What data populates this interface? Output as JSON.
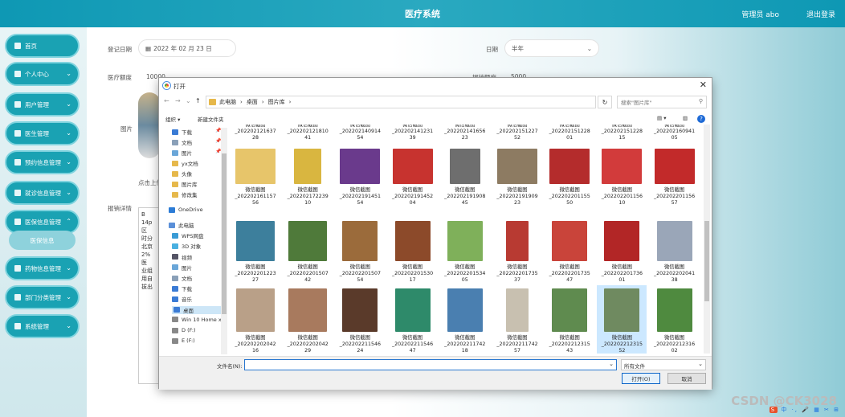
{
  "header": {
    "title": "医疗系统",
    "user": "管理员 abo",
    "logout": "退出登录"
  },
  "sidebar": {
    "items": [
      {
        "label": "首页",
        "arrow": ""
      },
      {
        "label": "个人中心",
        "arrow": "⌄"
      },
      {
        "label": "用户管理",
        "arrow": "⌄"
      },
      {
        "label": "医生管理",
        "arrow": "⌄"
      },
      {
        "label": "预约信息管理",
        "arrow": "⌄"
      },
      {
        "label": "就诊信息管理",
        "arrow": "⌄"
      },
      {
        "label": "医保信息管理",
        "arrow": "⌃"
      },
      {
        "label": "药物信息管理",
        "arrow": "⌄"
      },
      {
        "label": "部门分类管理",
        "arrow": "⌄"
      },
      {
        "label": "系统管理",
        "arrow": "⌄"
      }
    ],
    "sub": "医保信息"
  },
  "form": {
    "date_label": "登记日期",
    "date_value": "2022 年 02 月 23 日",
    "period_label": "日期",
    "period_value": "半年",
    "amount_label": "医疗额度",
    "amount_value": "10000",
    "reimb_label": "报销额度",
    "reimb_value": "5000",
    "image_label": "图片",
    "upload_hint": "点击上传",
    "detail_label": "报销详情",
    "editor_lines": [
      "B",
      "14p",
      "",
      "区",
      "时分",
      "北京",
      "2%",
      "",
      "医",
      "业组",
      "用自",
      "拔出"
    ]
  },
  "dialog": {
    "title": "打开",
    "breadcrumb": [
      "此电脑",
      "›",
      "桌面",
      "›",
      "图片库",
      "›"
    ],
    "search_placeholder": "搜索\"图片库\"",
    "organize": "组织 ▾",
    "new_folder": "新建文件夹",
    "tree": [
      {
        "label": "下载",
        "color": "#3a7bd5",
        "pin": "📌"
      },
      {
        "label": "文档",
        "color": "#8aa0b8",
        "pin": "📌"
      },
      {
        "label": "图片",
        "color": "#6aa6d8",
        "pin": "📌"
      },
      {
        "label": "yx文档",
        "color": "#e6b84b",
        "pin": ""
      },
      {
        "label": "头像",
        "color": "#e6b84b",
        "pin": ""
      },
      {
        "label": "图片库",
        "color": "#e6b84b",
        "pin": ""
      },
      {
        "label": "修改集",
        "color": "#e6b84b",
        "pin": ""
      },
      {
        "label": "OneDrive",
        "color": "#2c7cd6",
        "pin": ""
      },
      {
        "label": "此电脑",
        "color": "#5a8fd8",
        "pin": ""
      },
      {
        "label": "WPS网盘",
        "color": "#3a9bd5",
        "pin": ""
      },
      {
        "label": "3D 对象",
        "color": "#4ab0e0",
        "pin": ""
      },
      {
        "label": "视频",
        "color": "#556",
        "pin": ""
      },
      {
        "label": "图片",
        "color": "#6aa6d8",
        "pin": ""
      },
      {
        "label": "文档",
        "color": "#8aa0b8",
        "pin": ""
      },
      {
        "label": "下载",
        "color": "#3a7bd5",
        "pin": ""
      },
      {
        "label": "音乐",
        "color": "#3a7bd5",
        "pin": ""
      },
      {
        "label": "桌面",
        "color": "#3a7bd5",
        "pin": ""
      },
      {
        "label": "Win 10 Home x",
        "color": "#888",
        "pin": ""
      },
      {
        "label": "D (F:)",
        "color": "#888",
        "pin": ""
      },
      {
        "label": "E (F:)",
        "color": "#888",
        "pin": ""
      }
    ],
    "rows": [
      [
        {
          "l1": "微信截图",
          "l2": "_202202121637",
          "l3": "28",
          "c": "#ffffff"
        },
        {
          "l1": "微信截图",
          "l2": "_202202121810",
          "l3": "41",
          "c": "#ffffff"
        },
        {
          "l1": "微信截图",
          "l2": "_202202140914",
          "l3": "54",
          "c": "#ffffff"
        },
        {
          "l1": "微信截图",
          "l2": "_202202141231",
          "l3": "39",
          "c": "#ffffff"
        },
        {
          "l1": "微信截图",
          "l2": "_202202141656",
          "l3": "23",
          "c": "#ffffff"
        },
        {
          "l1": "微信截图",
          "l2": "_202202151227",
          "l3": "52",
          "c": "#ffffff"
        },
        {
          "l1": "微信截图",
          "l2": "_202202151228",
          "l3": "01",
          "c": "#ffffff"
        },
        {
          "l1": "微信截图",
          "l2": "_202202151228",
          "l3": "15",
          "c": "#ffffff"
        },
        {
          "l1": "微信截图",
          "l2": "_202202160941",
          "l3": "05",
          "c": "#ffffff"
        }
      ],
      [
        {
          "l1": "微信截图",
          "l2": "_202202161157",
          "l3": "56",
          "c": "#e7c56a"
        },
        {
          "l1": "微信截图",
          "l2": "_202202172239",
          "l3": "10",
          "c": "#d9b640"
        },
        {
          "l1": "微信截图",
          "l2": "_202202191451",
          "l3": "54",
          "c": "#6a3a8c"
        },
        {
          "l1": "微信截图",
          "l2": "_202202191452",
          "l3": "04",
          "c": "#c7332f"
        },
        {
          "l1": "微信截图",
          "l2": "_202202191908",
          "l3": "45",
          "c": "#6e6e6e"
        },
        {
          "l1": "微信截图",
          "l2": "_202202191909",
          "l3": "23",
          "c": "#8d7b62"
        },
        {
          "l1": "微信截图",
          "l2": "_202202201155",
          "l3": "50",
          "c": "#b42c2c"
        },
        {
          "l1": "微信截图",
          "l2": "_202202201156",
          "l3": "10",
          "c": "#d23b3b"
        },
        {
          "l1": "微信截图",
          "l2": "_202202201156",
          "l3": "57",
          "c": "#c22a2a"
        }
      ],
      [
        {
          "l1": "微信截图",
          "l2": "_202202201223",
          "l3": "27",
          "c": "#3d7f9c"
        },
        {
          "l1": "微信截图",
          "l2": "_202202201507",
          "l3": "42",
          "c": "#4f7a3a"
        },
        {
          "l1": "微信截图",
          "l2": "_202202201507",
          "l3": "54",
          "c": "#9b6b3b"
        },
        {
          "l1": "微信截图",
          "l2": "_202202201530",
          "l3": "17",
          "c": "#8c4a2a"
        },
        {
          "l1": "微信截图",
          "l2": "_202202201534",
          "l3": "05",
          "c": "#7fb05a"
        },
        {
          "l1": "微信截图",
          "l2": "_202202201735",
          "l3": "37",
          "c": "#b83a32"
        },
        {
          "l1": "微信截图",
          "l2": "_202202201735",
          "l3": "47",
          "c": "#c9443a"
        },
        {
          "l1": "微信截图",
          "l2": "_202202201736",
          "l3": "01",
          "c": "#b22626"
        },
        {
          "l1": "微信截图",
          "l2": "_202202202041",
          "l3": "38",
          "c": "#9aa6b8"
        }
      ],
      [
        {
          "l1": "微信截图",
          "l2": "_202202202042",
          "l3": "16",
          "c": "#b9a088"
        },
        {
          "l1": "微信截图",
          "l2": "_202202202042",
          "l3": "29",
          "c": "#a87a5e"
        },
        {
          "l1": "微信截图",
          "l2": "_202202211546",
          "l3": "24",
          "c": "#5a3a2a"
        },
        {
          "l1": "微信截图",
          "l2": "_202202211546",
          "l3": "47",
          "c": "#2e8a6a"
        },
        {
          "l1": "微信截图",
          "l2": "_202202211742",
          "l3": "18",
          "c": "#4a7fb0"
        },
        {
          "l1": "微信截图",
          "l2": "_202202211742",
          "l3": "57",
          "c": "#c8c0b0"
        },
        {
          "l1": "微信截图",
          "l2": "_202202212315",
          "l3": "43",
          "c": "#5f8b4f"
        },
        {
          "l1": "微信截图",
          "l2": "_202202212315",
          "l3": "52",
          "c": "#6f8a60"
        },
        {
          "l1": "微信截图",
          "l2": "_202202212316",
          "l3": "02",
          "c": "#4f8a3f"
        }
      ]
    ],
    "selected": "3-7",
    "filename_label": "文件名(N):",
    "filetype": "所有文件",
    "open": "打开(O)",
    "cancel": "取消"
  },
  "watermark": "CSDN @CK3028",
  "tray": "中 ·, 🎤 ▦ ✂ ⊞"
}
